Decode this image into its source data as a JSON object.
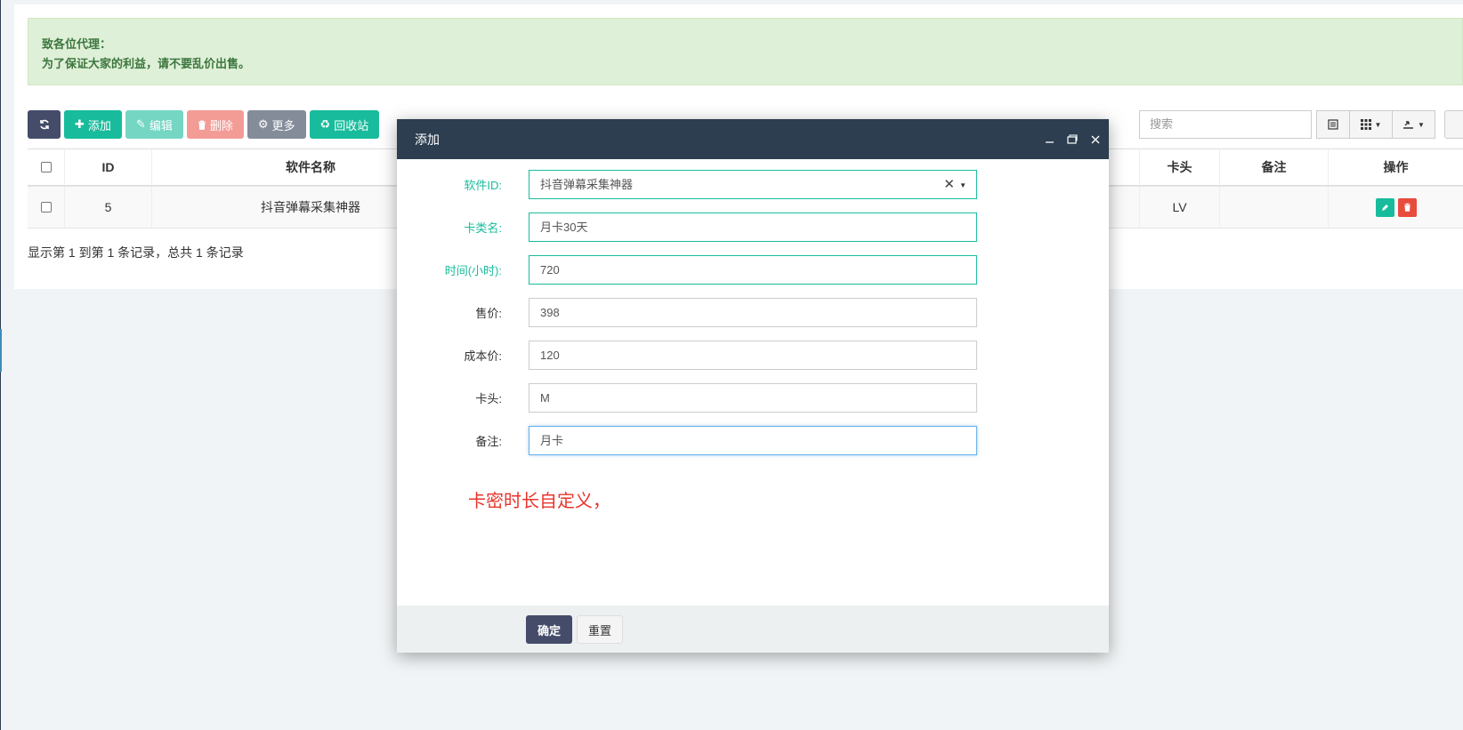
{
  "notice": {
    "line1": "致各位代理：",
    "line2": "为了保证大家的利益，请不要乱价出售。"
  },
  "toolbar": {
    "add": "添加",
    "edit": "编辑",
    "delete": "删除",
    "more": "更多",
    "recycle": "回收站"
  },
  "search": {
    "placeholder": "搜索"
  },
  "table": {
    "headers": {
      "id": "ID",
      "name": "软件名称",
      "head": "卡头",
      "remark": "备注",
      "ops": "操作"
    },
    "rows": [
      {
        "id": "5",
        "name": "抖音弹幕采集神器",
        "head": "LV",
        "remark": ""
      }
    ]
  },
  "pagination_info": "显示第 1 到第 1 条记录，总共 1 条记录",
  "modal": {
    "title": "添加",
    "fields": {
      "software_id": {
        "label": "软件ID:",
        "value": "抖音弹幕采集神器"
      },
      "card_name": {
        "label": "卡类名:",
        "value": "月卡30天"
      },
      "hours": {
        "label": "时间(小时):",
        "value": "720"
      },
      "price": {
        "label": "售价:",
        "value": "398"
      },
      "cost": {
        "label": "成本价:",
        "value": "120"
      },
      "prefix": {
        "label": "卡头:",
        "value": "M"
      },
      "remark": {
        "label": "备注:",
        "value": "月卡"
      }
    },
    "annotation": "卡密时长自定义，",
    "confirm": "确定",
    "reset": "重置"
  },
  "colors": {
    "primary": "#18bc9c",
    "dark": "#2c3e50",
    "danger": "#e74c3c",
    "note": "#e8352c"
  }
}
